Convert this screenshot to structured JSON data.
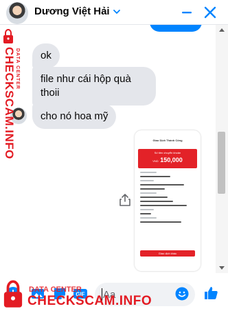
{
  "header": {
    "contact_name": "Dương Việt Hải",
    "icons": [
      "chevron-down-icon",
      "minimize-icon",
      "close-icon"
    ],
    "accent_color": "#0084ff"
  },
  "messages": [
    {
      "sender": "contact",
      "text": "ok"
    },
    {
      "sender": "contact",
      "text": "file như cái hộp quà thoii"
    },
    {
      "sender": "contact",
      "text": "cho nó hoa mỹ"
    }
  ],
  "shared_image": {
    "title": "Giao Dịch Thành Công",
    "subtitle": "Số tiền chuyển khoản",
    "currency": "VND",
    "amount": "150,000",
    "button_label": "Giao dịch khác"
  },
  "composer": {
    "placeholder": "Aa",
    "gif_label": "GIF",
    "icons": [
      "plus-icon",
      "photo-icon",
      "sticker-icon",
      "gif-icon",
      "emoji-icon",
      "like-icon"
    ]
  },
  "watermark": {
    "brand": "CHECKSCAM.INFO",
    "tag": "DATA CENTER",
    "color": "#e31b23"
  }
}
